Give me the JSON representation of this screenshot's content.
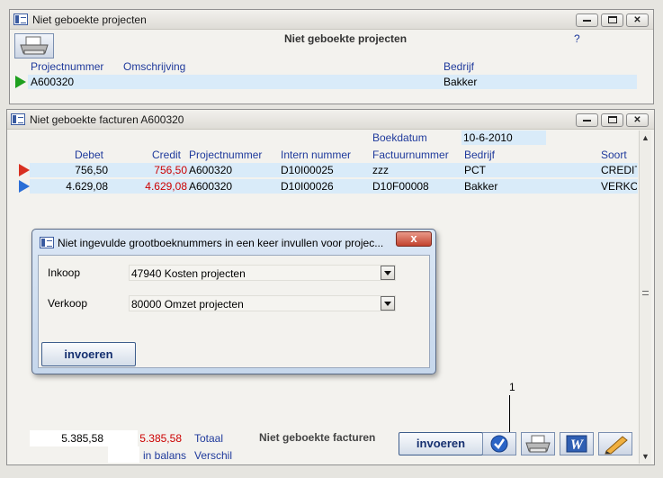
{
  "win1": {
    "title": "Niet geboekte projecten",
    "heading": "Niet geboekte projecten",
    "help": "?",
    "columns": [
      "Projectnummer",
      "Omschrijving",
      "Bedrijf"
    ],
    "row": {
      "projectnummer": "A600320",
      "omschrijving": "",
      "bedrijf": "Bakker"
    }
  },
  "win2": {
    "title": "Niet geboekte facturen A600320",
    "boekdatum_label": "Boekdatum",
    "boekdatum_value": "10-6-2010",
    "columns": [
      "Debet",
      "Credit",
      "Projectnummer",
      "Intern nummer",
      "Factuurnummer",
      "Bedrijf",
      "Soort"
    ],
    "rows": [
      {
        "debet": "756,50",
        "credit": "756,50",
        "project": "A600320",
        "intern": "D10I00025",
        "factuur": "zzz",
        "bedrijf": "PCT",
        "soort": "CREDIT"
      },
      {
        "debet": "4.629,08",
        "credit": "4.629,08",
        "project": "A600320",
        "intern": "D10I00026",
        "factuur": "D10F00008",
        "bedrijf": "Bakker",
        "soort": "VERKOO"
      }
    ],
    "footer": {
      "total_debet": "5.385,58",
      "total_credit": "5.385,58",
      "totaal_label": "Totaal",
      "in_balans": "in balans",
      "verschil_label": "Verschil",
      "caption": "Niet geboekte facturen",
      "invoeren": "invoeren",
      "callout_number": "1"
    }
  },
  "dialog": {
    "title": "Niet ingevulde grootboeknummers in een keer invullen voor projec...",
    "close": "x",
    "inkoop_label": "Inkoop",
    "inkoop_value": "47940  Kosten projecten",
    "verkoop_label": "Verkoop",
    "verkoop_value": "80000  Omzet projecten",
    "invoeren": "invoeren"
  },
  "icons": {
    "printer": "printer-icon",
    "check": "check-icon",
    "word": "word-icon",
    "edit": "pencil-icon"
  },
  "colors": {
    "row_highlight": "#d9ebf9",
    "header_text": "#1f3a9c",
    "credit_red": "#cc0000"
  }
}
